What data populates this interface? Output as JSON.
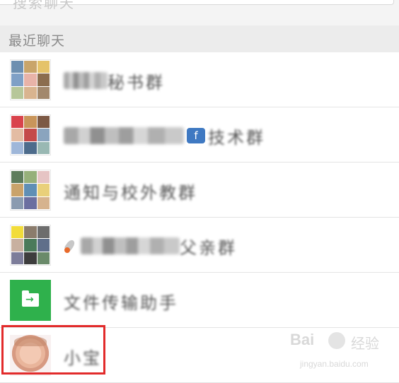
{
  "search": {
    "placeholder": "搜索聊天"
  },
  "section": {
    "title": "最近聊天"
  },
  "chats": [
    {
      "id": "group-1",
      "name": "秘书群",
      "type": "group"
    },
    {
      "id": "group-2",
      "name": "技术群",
      "type": "group",
      "badge": "f"
    },
    {
      "id": "group-3",
      "name": "通知与校外教群",
      "type": "group"
    },
    {
      "id": "group-4",
      "name": "父亲群",
      "type": "group"
    },
    {
      "id": "file-transfer",
      "name": "文件传输助手",
      "type": "service"
    },
    {
      "id": "contact-1",
      "name": "小宝",
      "type": "contact"
    }
  ],
  "watermark": {
    "brand": "Bai",
    "brand_suffix": "经验",
    "url": "jingyan.baidu.com"
  },
  "colors": {
    "accent_green": "#2fb14c",
    "highlight_red": "#e22b2b",
    "badge_blue": "#3f79c2"
  }
}
